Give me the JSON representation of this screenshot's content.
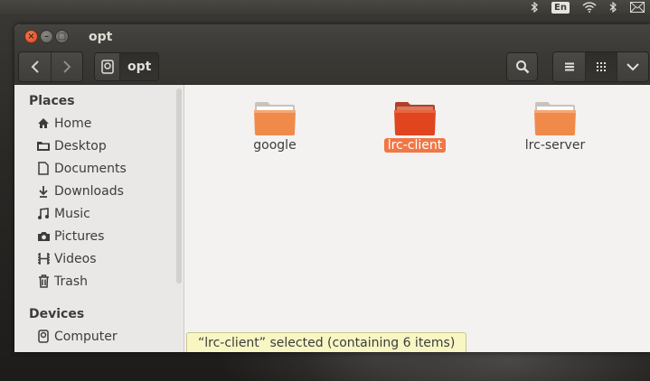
{
  "window": {
    "title": "opt"
  },
  "top_panel": {
    "lang": "En"
  },
  "toolbar": {
    "back_icon": "chevron-left-icon",
    "forward_icon": "chevron-right-icon",
    "path_segment": "opt",
    "search_icon": "search-icon",
    "list_view_icon": "list-view-icon",
    "grid_view_icon": "grid-view-icon",
    "menu_icon": "chevron-down-icon"
  },
  "sidebar": {
    "places_heading": "Places",
    "places": [
      {
        "label": "Home",
        "icon": "home-icon"
      },
      {
        "label": "Desktop",
        "icon": "desktop-icon"
      },
      {
        "label": "Documents",
        "icon": "documents-icon"
      },
      {
        "label": "Downloads",
        "icon": "downloads-icon"
      },
      {
        "label": "Music",
        "icon": "music-icon"
      },
      {
        "label": "Pictures",
        "icon": "pictures-icon"
      },
      {
        "label": "Videos",
        "icon": "videos-icon"
      },
      {
        "label": "Trash",
        "icon": "trash-icon"
      }
    ],
    "devices_heading": "Devices",
    "devices": [
      {
        "label": "Computer",
        "icon": "computer-icon"
      }
    ]
  },
  "files": [
    {
      "name": "google",
      "selected": false
    },
    {
      "name": "lrc-client",
      "selected": true
    },
    {
      "name": "lrc-server",
      "selected": false
    }
  ],
  "status": {
    "text": "“lrc-client” selected  (containing 6 items)"
  },
  "colors": {
    "accent": "#f07746",
    "folder_orange": "#f08a4b",
    "folder_selected": "#e0451f",
    "titlebar": "#3c3b37"
  }
}
